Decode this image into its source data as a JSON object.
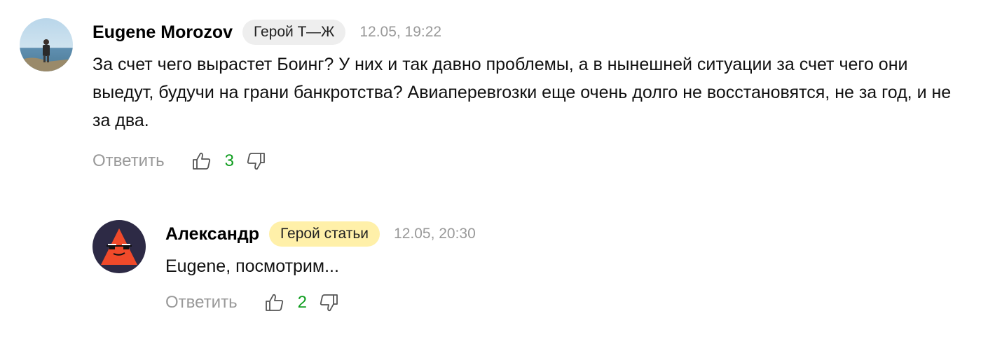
{
  "comments": [
    {
      "author": "Eugene Morozov",
      "badge": "Герой Т—Ж",
      "timestamp": "12.05, 19:22",
      "text": "За счет чего вырастет Боинг? У них и так давно проблемы, а в нынешней ситуации за счет чего они выедут, будучи на грани банкротства? Авиаперевrозки еще очень долго не восстановятся, не за год, и не за два.",
      "reply_label": "Ответить",
      "likes": "3",
      "colors": {
        "badge_bg": "#eeeeee"
      }
    },
    {
      "author": "Александр",
      "badge": "Герой статьи",
      "timestamp": "12.05, 20:30",
      "text": "Eugene, посмотрим...",
      "reply_label": "Ответить",
      "likes": "2",
      "colors": {
        "badge_bg": "#fff0a9"
      }
    }
  ],
  "colors": {
    "likes_count": "#0f9d1f",
    "muted": "#999999",
    "avatar2_bg": "#2d2a45",
    "avatar2_triangle": "#f04a2a"
  },
  "icons": {
    "like": "thumbs-up-icon",
    "dislike": "thumbs-down-icon"
  }
}
